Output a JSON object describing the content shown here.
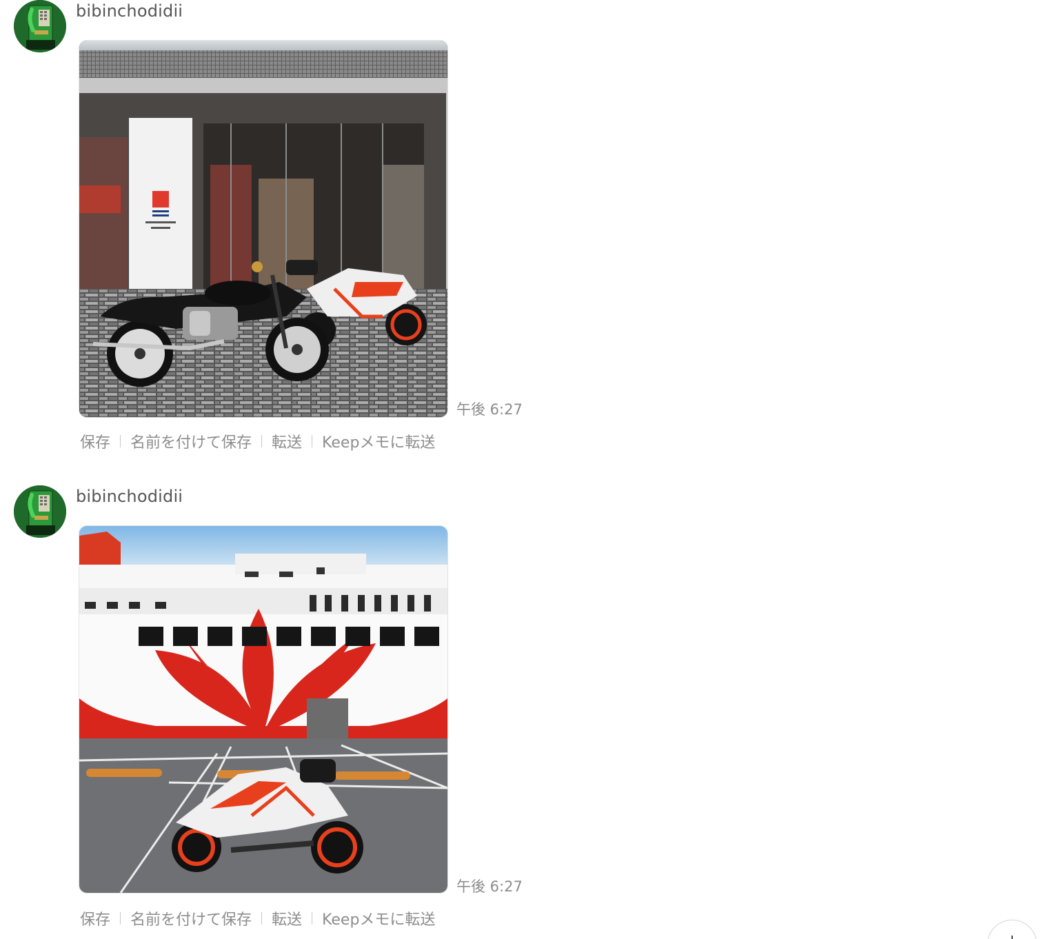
{
  "messages": [
    {
      "sender": "bibinchodidii",
      "time": "午後 6:27",
      "actions": [
        "保存",
        "名前を付けて保存",
        "転送",
        "Keepメモに転送"
      ]
    },
    {
      "sender": "bibinchodidii",
      "time": "午後 6:27",
      "actions": [
        "保存",
        "名前を付けて保存",
        "転送",
        "Keepメモに転送"
      ]
    }
  ],
  "colors": {
    "sender_text": "#555555",
    "meta_text": "#8b8b8b",
    "ship_red": "#d9261c",
    "ktm_orange": "#e8401c"
  },
  "icons": {
    "avatar": "green-payphone-avatar",
    "scroll": "scroll-down-button"
  }
}
